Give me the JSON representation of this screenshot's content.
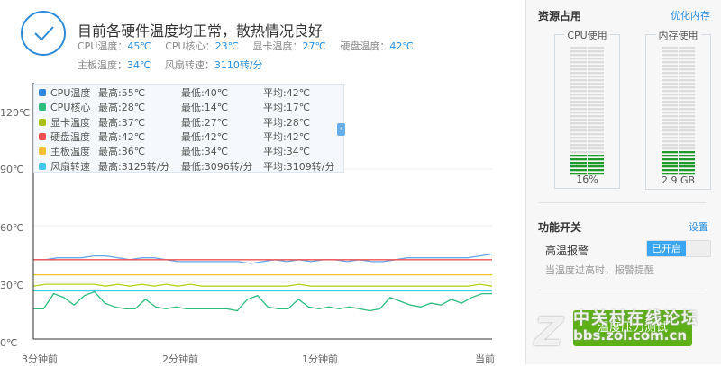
{
  "status": {
    "title": "目前各硬件温度均正常，散热情况良好",
    "items": [
      {
        "label": "CPU温度：",
        "value": "45℃"
      },
      {
        "label": "CPU核心：",
        "value": "23℃"
      },
      {
        "label": "显卡温度：",
        "value": "27℃"
      },
      {
        "label": "硬盘温度：",
        "value": "42℃"
      },
      {
        "label": "主板温度：",
        "value": "34℃"
      },
      {
        "label": "风扇转速：",
        "value": "3110转/分"
      }
    ]
  },
  "legend": [
    {
      "name": "CPU温度",
      "max": "最高:55℃",
      "min": "最低:40℃",
      "avg": "平均:42℃",
      "color": "#2f86df"
    },
    {
      "name": "CPU核心",
      "max": "最高:28℃",
      "min": "最低:14℃",
      "avg": "平均:17℃",
      "color": "#2dbd7e"
    },
    {
      "name": "显卡温度",
      "max": "最高:37℃",
      "min": "最低:27℃",
      "avg": "平均:28℃",
      "color": "#a6c20a"
    },
    {
      "name": "硬盘温度",
      "max": "最高:42℃",
      "min": "最低:42℃",
      "avg": "平均:42℃",
      "color": "#f05050"
    },
    {
      "name": "主板温度",
      "max": "最高:36℃",
      "min": "最低:34℃",
      "avg": "平均:34℃",
      "color": "#f8c030"
    },
    {
      "name": "风扇转速",
      "max": "最高:3125转/分",
      "min": "最低:3096转/分",
      "avg": "平均:3109转/分",
      "color": "#40c8ef"
    }
  ],
  "chart_data": {
    "type": "line",
    "ylim": [
      0,
      120
    ],
    "yticks": [
      "0℃",
      "30℃",
      "60℃",
      "90℃",
      "120℃"
    ],
    "xticks": [
      "3分钟前",
      "2分钟前",
      "1分钟前",
      "当前"
    ],
    "series": [
      {
        "name": "CPU温度",
        "color": "#6aa6e8",
        "values": [
          42,
          42,
          43,
          43,
          43,
          44,
          44,
          43,
          42,
          43,
          43,
          42,
          41,
          41,
          41,
          41,
          41,
          41,
          40,
          41,
          42,
          41,
          42,
          41,
          42,
          42,
          41,
          42,
          41,
          41,
          42,
          43,
          43,
          43,
          43,
          43,
          43,
          44,
          45
        ]
      },
      {
        "name": "硬盘温度",
        "color": "#f05050",
        "values": [
          42,
          42
        ]
      },
      {
        "name": "主板温度",
        "color": "#f8c030",
        "values": [
          34,
          34
        ]
      },
      {
        "name": "显卡温度",
        "color": "#b8d020",
        "values": [
          28,
          29,
          29,
          29,
          29,
          29,
          28,
          29,
          28,
          29,
          28,
          29,
          28,
          29,
          28,
          28,
          28,
          28,
          28,
          28,
          28,
          28,
          29,
          28,
          28,
          28,
          28,
          28,
          28,
          28,
          28,
          28,
          28,
          28,
          28,
          28,
          28,
          29,
          28
        ]
      },
      {
        "name": "风扇转速",
        "color": "#40c8ef",
        "rpm": true,
        "values": [
          3110,
          3110
        ]
      },
      {
        "name": "CPU核心",
        "color": "#2dbd7e",
        "values": [
          16,
          16,
          24,
          22,
          18,
          23,
          25,
          19,
          17,
          16,
          16,
          21,
          17,
          16,
          17,
          16,
          16,
          16,
          16,
          16,
          15,
          21,
          23,
          17,
          16,
          16,
          21,
          17,
          16,
          17,
          16,
          17,
          16,
          15,
          16,
          22,
          20,
          18,
          17,
          19,
          18,
          21,
          19,
          22,
          24,
          24
        ]
      }
    ]
  },
  "side": {
    "resource_title": "资源占用",
    "optimize": "优化内存",
    "cpu_label": "CPU使用",
    "cpu_value": "16%",
    "cpu_fraction": 0.16,
    "mem_label": "内存使用",
    "mem_value": "2.9 GB",
    "mem_fraction": 0.2,
    "switch_title": "功能开关",
    "settings": "设置",
    "alarm_label": "高温报警",
    "alarm_state": "已开启",
    "alarm_desc": "当温度过高时，报警提醒",
    "stress_button": "温度压力测试"
  },
  "watermark": {
    "line1": "中关村在线论坛",
    "line2": "bbs.zol.com.cn"
  }
}
